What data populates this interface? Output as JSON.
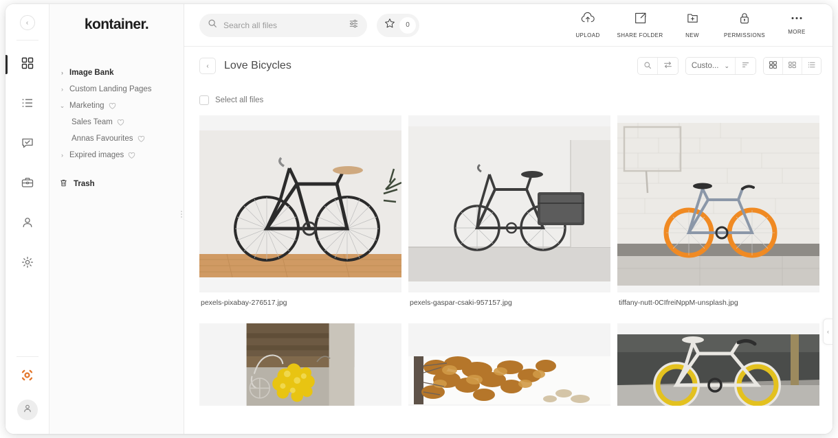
{
  "brand": "kontainer.",
  "icon_rail": {
    "collapse_label": "‹",
    "items": [
      {
        "name": "grid-dashboard",
        "active": true
      },
      {
        "name": "list",
        "active": false
      },
      {
        "name": "chat-check",
        "active": false
      },
      {
        "name": "briefcase",
        "active": false
      },
      {
        "name": "person",
        "active": false
      },
      {
        "name": "gear",
        "active": false
      }
    ],
    "support_icon": "lifebuoy-icon",
    "support_color": "#e3762b",
    "avatar_icon": "user-avatar-icon"
  },
  "sidebar": {
    "tree": [
      {
        "label": "Image Bank",
        "caret": "›",
        "bold": true,
        "child": false,
        "heart": false
      },
      {
        "label": "Custom Landing Pages",
        "caret": "›",
        "bold": false,
        "child": false,
        "heart": false
      },
      {
        "label": "Marketing",
        "caret": "⌄",
        "bold": false,
        "child": false,
        "heart": true
      },
      {
        "label": "Sales Team",
        "caret": "",
        "bold": false,
        "child": true,
        "heart": true
      },
      {
        "label": "Annas Favourites",
        "caret": "",
        "bold": false,
        "child": true,
        "heart": true
      },
      {
        "label": "Expired images",
        "caret": "›",
        "bold": false,
        "child": false,
        "heart": true
      }
    ],
    "trash_label": "Trash"
  },
  "topbar": {
    "search_placeholder": "Search all files",
    "search_value": "",
    "filter_icon": "sliders-icon",
    "star_icon": "star-icon",
    "star_count": "0",
    "actions": [
      {
        "label": "UPLOAD",
        "icon": "cloud-upload-icon"
      },
      {
        "label": "SHARE FOLDER",
        "icon": "share-folder-icon"
      },
      {
        "label": "NEW",
        "icon": "folder-plus-icon"
      },
      {
        "label": "PERMISSIONS",
        "icon": "lock-icon"
      },
      {
        "label": "MORE",
        "icon": "more-dots-icon"
      }
    ]
  },
  "subbar": {
    "back_label": "‹",
    "title": "Love Bicycles",
    "search_icon": "search-icon",
    "swap_icon": "transfer-icon",
    "sort_value": "Custo...",
    "sort_caret": "⌄",
    "sort_order_icon": "sort-lines-icon",
    "views": [
      {
        "name": "grid-view",
        "active": true
      },
      {
        "name": "card-view",
        "active": false
      },
      {
        "name": "list-view",
        "active": false
      }
    ]
  },
  "content": {
    "select_all_label": "Select all files",
    "select_all_checked": false,
    "files": [
      {
        "name": "pexels-pixabay-276517.jpg",
        "kind": "road-bike-wood-floor"
      },
      {
        "name": "pexels-gaspar-csaki-957157.jpg",
        "kind": "cargo-bike-concrete"
      },
      {
        "name": "tiffany-nutt-0CIfreiNppM-unsplash.jpg",
        "kind": "orange-wheel-bike-brick"
      },
      {
        "name": "",
        "kind": "yellow-flowers-bike"
      },
      {
        "name": "",
        "kind": "autumn-tree"
      },
      {
        "name": "",
        "kind": "yellow-white-bike"
      }
    ]
  },
  "right_panel": {
    "toggle_label": "‹"
  }
}
